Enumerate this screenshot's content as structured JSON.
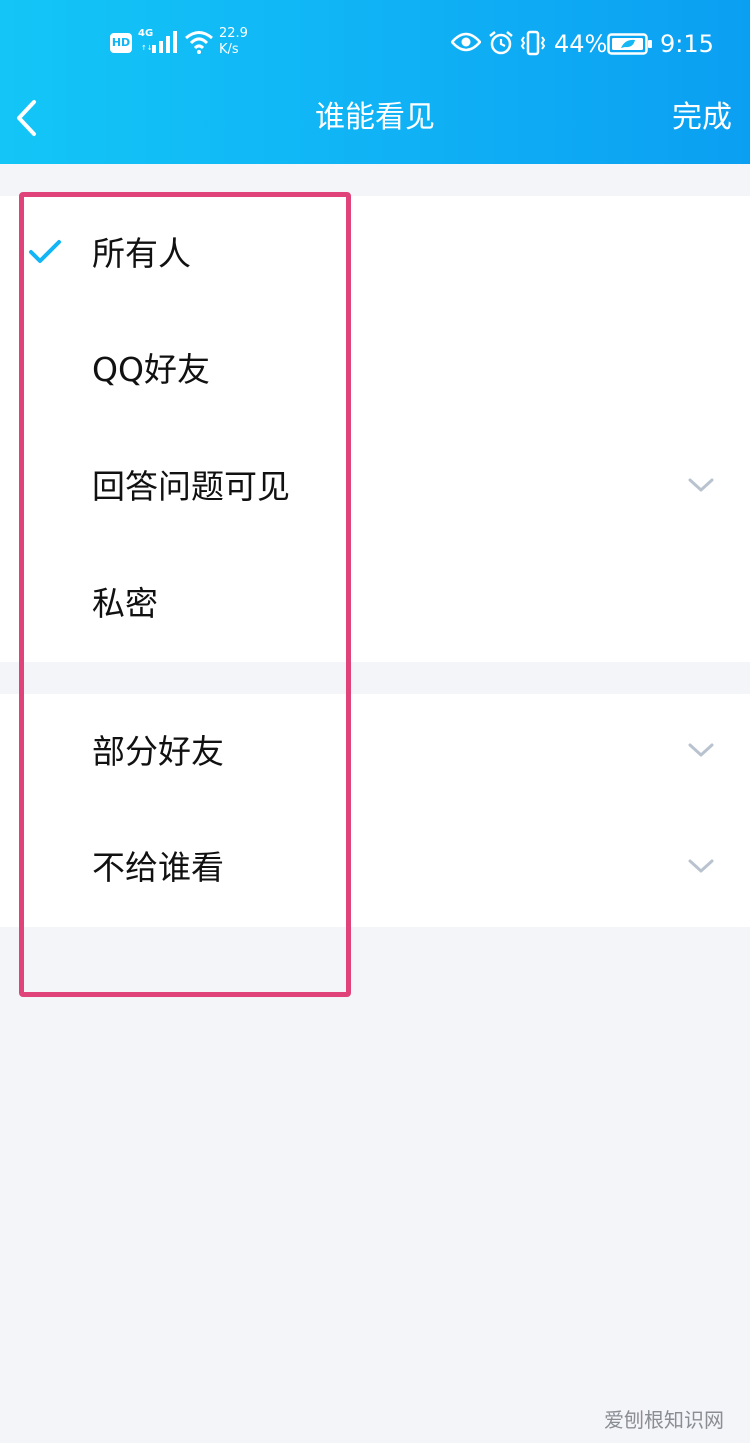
{
  "status_bar": {
    "hd": "HD",
    "network": "4G",
    "network_sub": "↑↓",
    "speed_value": "22.9",
    "speed_unit": "K/s",
    "battery_percent": "44%",
    "time": "9:15"
  },
  "header": {
    "title": "谁能看见",
    "done_label": "完成",
    "back_icon": "chevron-left-icon"
  },
  "options_group1": [
    {
      "label": "所有人",
      "selected": true,
      "expandable": false
    },
    {
      "label": "QQ好友",
      "selected": false,
      "expandable": false
    },
    {
      "label": "回答问题可见",
      "selected": false,
      "expandable": true
    },
    {
      "label": "私密",
      "selected": false,
      "expandable": false
    }
  ],
  "options_group2": [
    {
      "label": "部分好友",
      "selected": false,
      "expandable": true
    },
    {
      "label": "不给谁看",
      "selected": false,
      "expandable": true
    }
  ],
  "colors": {
    "header_start": "#13c6f7",
    "header_end": "#0b9ff2",
    "check": "#12b5f5",
    "highlight": "#e0437a",
    "chevron": "#b9c3cf"
  },
  "watermark": "爱刨根知识网"
}
